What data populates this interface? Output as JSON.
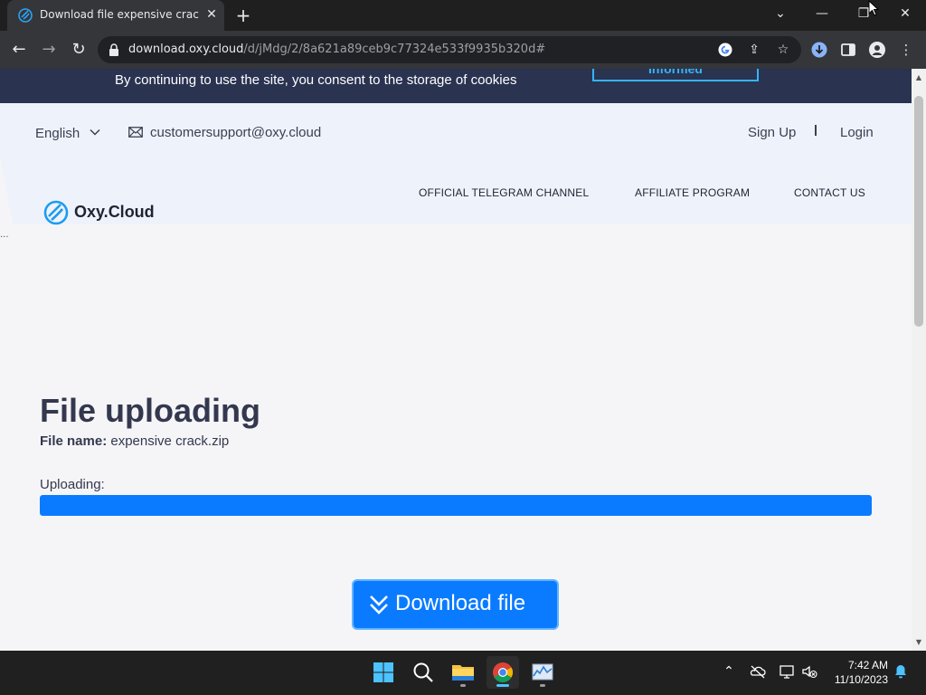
{
  "browser": {
    "tab_title": "Download file expensive crack.zip",
    "url_host": "download.oxy.cloud",
    "url_path": "/d/jMdg/2/8a621a89ceb9c77324e533f9935b320d#"
  },
  "cookie_bar": {
    "text": "By continuing to use the site, you consent to the storage of cookies",
    "button_label": "Informed"
  },
  "header": {
    "language": "English",
    "email": "customersupport@oxy.cloud",
    "sign_up": "Sign Up",
    "login": "Login",
    "logo_text": "Oxy.Cloud",
    "nav": [
      "OFFICIAL TELEGRAM CHANNEL",
      "AFFILIATE PROGRAM",
      "CONTACT US"
    ]
  },
  "main": {
    "title": "File uploading",
    "file_name_label": "File name:",
    "file_name": "expensive crack.zip",
    "uploading_label": "Uploading:",
    "progress_fraction": 1.0,
    "download_button": "Download file",
    "ellipsis": "..."
  },
  "taskbar": {
    "time": "7:42 AM",
    "date": "11/10/2023"
  },
  "colors": {
    "accent": "#0a7bff",
    "cookie_bar": "#2a3350",
    "header_bg": "#eef3fb",
    "text_dark": "#34384f"
  }
}
